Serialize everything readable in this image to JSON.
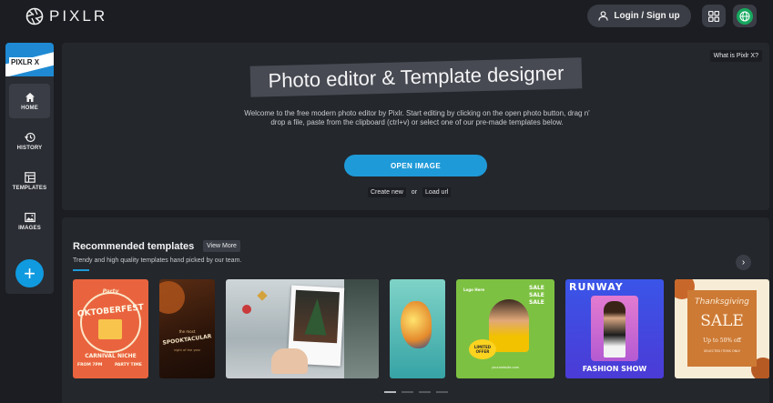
{
  "header": {
    "brand": "PIXLR",
    "login_label": "Login / Sign up",
    "logo_icon": "aperture-icon",
    "user_icon": "user-icon",
    "apps_icon": "grid-icon",
    "language_icon": "globe-icon"
  },
  "sidebar": {
    "badge": "PIXLR X",
    "items": [
      {
        "label": "HOME",
        "icon": "home-icon",
        "active": true
      },
      {
        "label": "HISTORY",
        "icon": "history-icon",
        "active": false
      },
      {
        "label": "TEMPLATES",
        "icon": "templates-icon",
        "active": false
      },
      {
        "label": "IMAGES",
        "icon": "image-icon",
        "active": false
      }
    ],
    "add_label": "+"
  },
  "hero": {
    "whatis": "What is Pixlr X?",
    "title": "Photo editor & Template designer",
    "description": "Welcome to the free modern photo editor by Pixlr. Start editing by clicking on the open photo button, drag n' drop a file, paste from the clipboard (ctrl+v) or select one of our pre-made templates below.",
    "open_button": "OPEN IMAGE",
    "create_new": "Create new",
    "or": "or",
    "load_url": "Load url"
  },
  "templates": {
    "title": "Recommended templates",
    "view_more": "View More",
    "subtitle": "Trendy and high quality templates hand picked by our team.",
    "next_icon": "chevron-right-icon",
    "cards": {
      "oktoberfest": {
        "top": "Party",
        "headline": "OKTOBERFEST",
        "bottom": "CARNIVAL NICHE",
        "left": "FROM 7PM",
        "right": "PARTY TIME"
      },
      "spooktacular": {
        "line1": "the most",
        "headline": "SPOOKTACULAR",
        "line3": "night of the year"
      },
      "polaroid": {},
      "fish": {},
      "sale": {
        "label1": "Logo Here",
        "sale": "SALE",
        "badge": "LIMITED OFFER",
        "url": "yourwebsite.com"
      },
      "runway": {
        "top": "RUNWAY",
        "bottom": "FASHION SHOW"
      },
      "thanksgiving": {
        "headline": "Thanksgiving",
        "sale": "SALE",
        "offer": "Up to 50% off",
        "small": "SELECTED ITEMS ONLY"
      }
    },
    "page_count": 4,
    "active_page": 1
  }
}
